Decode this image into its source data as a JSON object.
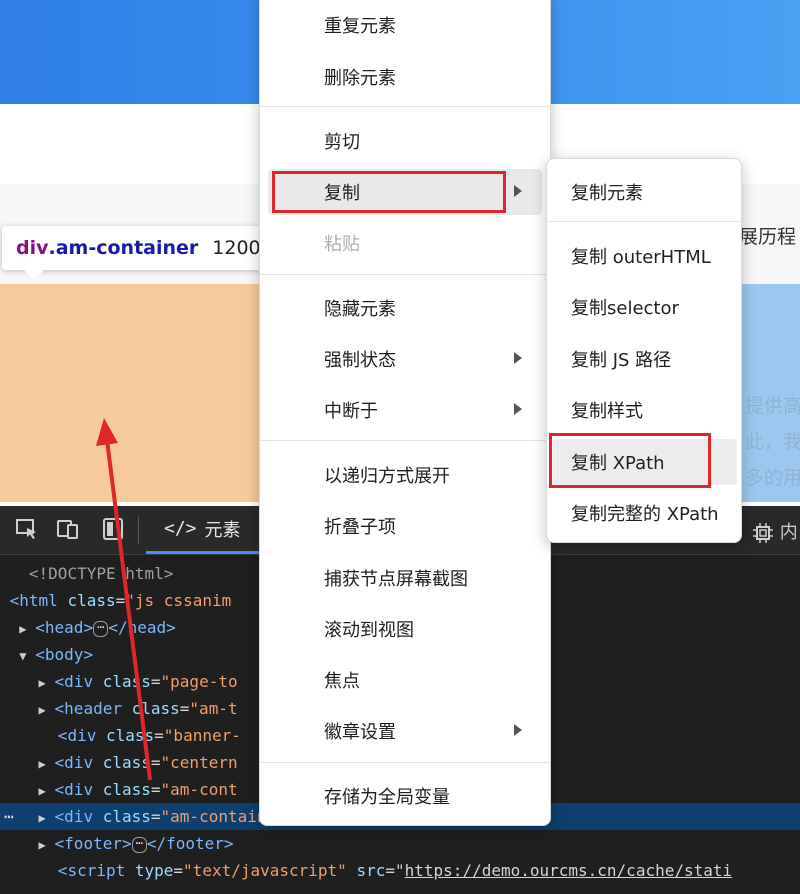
{
  "page": {
    "right_text": "发展历程",
    "right_text_lines": "提供高\n此，我\n多的用"
  },
  "tooltip": {
    "tag": "div",
    "class_name": ".am-container",
    "dims": "1200"
  },
  "devtools": {
    "tab_elements_icon": "</>",
    "tab_elements_label": "元素",
    "right_tool_label": "内",
    "dom_lines": {
      "doctype": "<!DOCTYPE html>",
      "html_open_tag": "html",
      "html_class_attr": "class",
      "html_class_val": "\"js cssanim",
      "head_tag": "head",
      "head_close": "/head",
      "body_tag": "body",
      "div1_tag": "div",
      "div1_attr": "class",
      "div1_val": "\"page-to",
      "header_tag": "header",
      "header_attr": "class",
      "header_val": "\"am-t",
      "div_banner_tag": "div",
      "div_banner_attr": "class",
      "div_banner_val": "\"banner-",
      "div_center_tag": "div",
      "div_center_attr": "class",
      "div_center_val": "\"centern",
      "div_amcont_tag": "div",
      "div_amcont_attr": "class",
      "div_amcont_val": "\"am-cont",
      "sel_div_tag": "div",
      "sel_div_attr": "class",
      "sel_div_val": "\"am-container",
      "footer_tag": "footer",
      "footer_close": "/footer",
      "script_tag": "script",
      "script_type_attr": "type",
      "script_type_val": "\"text/javascript\"",
      "script_src_attr": "src",
      "script_src_val": "https://demo.ourcms.cn/cache/stati"
    },
    "ellipsis": "⋯"
  },
  "context_menu": {
    "items": [
      {
        "label": "重复元素"
      },
      {
        "label": "删除元素"
      },
      {
        "label": "剪切"
      },
      {
        "label": "复制"
      },
      {
        "label": "粘贴"
      },
      {
        "label": "隐藏元素"
      },
      {
        "label": "强制状态"
      },
      {
        "label": "中断于"
      },
      {
        "label": "以递归方式展开"
      },
      {
        "label": "折叠子项"
      },
      {
        "label": "捕获节点屏幕截图"
      },
      {
        "label": "滚动到视图"
      },
      {
        "label": "焦点"
      },
      {
        "label": "徽章设置"
      },
      {
        "label": "存储为全局变量"
      }
    ]
  },
  "submenu": {
    "items": [
      {
        "label": "复制元素"
      },
      {
        "label": "复制 outerHTML"
      },
      {
        "label": "复制selector"
      },
      {
        "label": "复制 JS 路径"
      },
      {
        "label": "复制样式"
      },
      {
        "label": "复制 XPath"
      },
      {
        "label": "复制完整的 XPath"
      }
    ]
  },
  "colors": {
    "annotation_red": "#e0262b",
    "highlight_orange": "#f6ca9a",
    "devtools_bg": "#1f1f1f",
    "selection_blue": "#0e3f6e"
  }
}
